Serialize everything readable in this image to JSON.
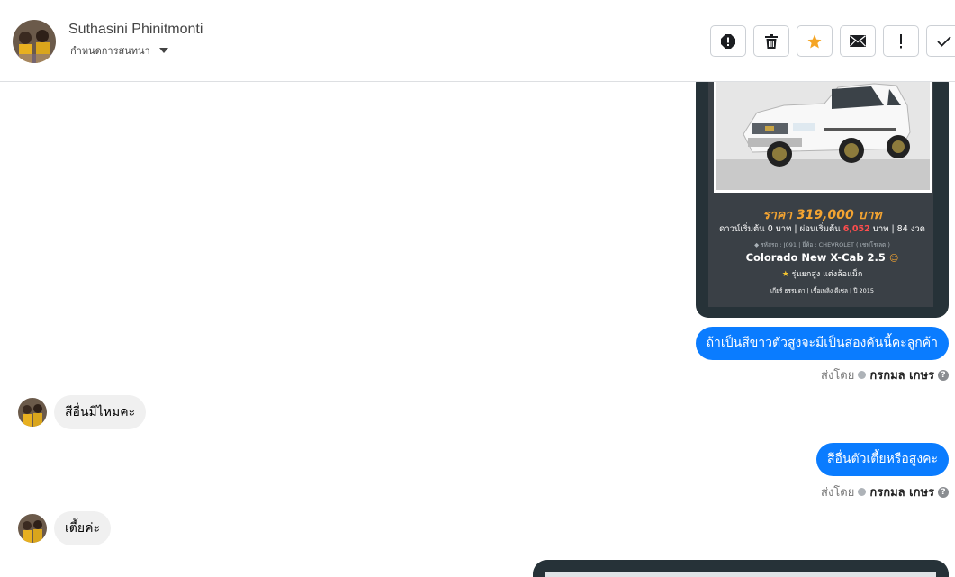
{
  "header": {
    "contact_name": "Suthasini Phinitmonti",
    "assign_label": "กำหนดการสนทนา",
    "action_icons": [
      "alert-octagon-icon",
      "trash-icon",
      "star-icon",
      "envelope-icon",
      "exclamation-icon",
      "checkmark-icon"
    ]
  },
  "car_card": {
    "price": "ราคา 319,000 บาท",
    "down_prefix": "ดาวน์เริ่มต้น 0 บาท | ผ่อนเริ่มต้น",
    "installment": "6,052",
    "down_suffix": "บาท | 84 งวด",
    "code_line": "รหัสรถ : J091 | ยี่ห้อ : CHEVROLET ( เชฟโรเลต )",
    "model": "Colorado New X-Cab 2.5",
    "subtitle": "รุ่นยกสูง แต่งล้อแม็ก",
    "specs": "เกียร์ ธรรมดา  |  เชื้อเพลิง ดีเซล  |  ปี 2015"
  },
  "messages": {
    "out_1": "ถ้าเป็นสีขาวตัวสูงจะมีเป็นสองคันนี้คะลูกค้า",
    "in_1": "สีอื่นมีไหมคะ",
    "out_2": "สีอื่นตัวเตี้ยหรือสูงคะ",
    "in_2": "เตี้ยค่ะ"
  },
  "sent_by": {
    "label": "ส่งโดย",
    "agent": "กรกมล เกษร",
    "help": "?"
  },
  "colors": {
    "outgoing_bubble": "#0a7cff",
    "incoming_bubble": "#f0f0f0",
    "card_bg": "#263238",
    "price": "#f4a431"
  }
}
